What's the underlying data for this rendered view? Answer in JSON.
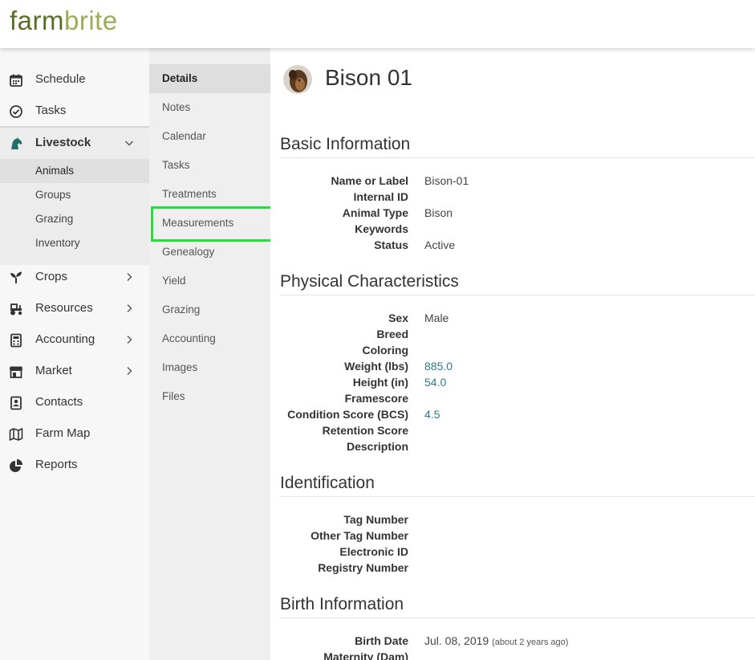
{
  "brand": {
    "part1": "farm",
    "part2": "brite"
  },
  "sidebar": {
    "items": [
      {
        "label": "Schedule",
        "icon": "calendar-icon"
      },
      {
        "label": "Tasks",
        "icon": "check-circle-icon"
      },
      {
        "label": "Livestock",
        "icon": "horse-icon",
        "expanded": true
      },
      {
        "label": "Crops",
        "icon": "sprout-icon"
      },
      {
        "label": "Resources",
        "icon": "tractor-icon"
      },
      {
        "label": "Accounting",
        "icon": "calculator-icon"
      },
      {
        "label": "Market",
        "icon": "store-icon"
      },
      {
        "label": "Contacts",
        "icon": "contact-card-icon"
      },
      {
        "label": "Farm Map",
        "icon": "map-icon"
      },
      {
        "label": "Reports",
        "icon": "pie-chart-icon"
      }
    ],
    "livestock_sub": [
      {
        "label": "Animals",
        "active": true
      },
      {
        "label": "Groups"
      },
      {
        "label": "Grazing"
      },
      {
        "label": "Inventory"
      }
    ]
  },
  "subnav": {
    "items": [
      {
        "label": "Details",
        "active": true
      },
      {
        "label": "Notes"
      },
      {
        "label": "Calendar"
      },
      {
        "label": "Tasks"
      },
      {
        "label": "Treatments"
      },
      {
        "label": "Measurements"
      },
      {
        "label": "Genealogy"
      },
      {
        "label": "Yield"
      },
      {
        "label": "Grazing"
      },
      {
        "label": "Accounting"
      },
      {
        "label": "Images"
      },
      {
        "label": "Files"
      }
    ]
  },
  "main": {
    "title": "Bison 01",
    "sections": {
      "basic": {
        "title": "Basic Information",
        "rows": [
          {
            "label": "Name or Label",
            "value": "Bison-01"
          },
          {
            "label": "Internal ID",
            "value": ""
          },
          {
            "label": "Animal Type",
            "value": "Bison"
          },
          {
            "label": "Keywords",
            "value": ""
          },
          {
            "label": "Status",
            "value": "Active"
          }
        ]
      },
      "physical": {
        "title": "Physical Characteristics",
        "rows": [
          {
            "label": "Sex",
            "value": "Male"
          },
          {
            "label": "Breed",
            "value": ""
          },
          {
            "label": "Coloring",
            "value": ""
          },
          {
            "label": "Weight (lbs)",
            "value": "885.0"
          },
          {
            "label": "Height (in)",
            "value": "54.0"
          },
          {
            "label": "Framescore",
            "value": ""
          },
          {
            "label": "Condition Score (BCS)",
            "value": "4.5"
          },
          {
            "label": "Retention Score",
            "value": ""
          },
          {
            "label": "Description",
            "value": ""
          }
        ]
      },
      "identification": {
        "title": "Identification",
        "rows": [
          {
            "label": "Tag Number",
            "value": ""
          },
          {
            "label": "Other Tag Number",
            "value": ""
          },
          {
            "label": "Electronic ID",
            "value": ""
          },
          {
            "label": "Registry Number",
            "value": ""
          }
        ]
      },
      "birth": {
        "title": "Birth Information",
        "rows": [
          {
            "label": "Birth Date",
            "value": "Jul. 08, 2019",
            "note": "(about 2 years ago)"
          },
          {
            "label": "Maternity (Dam)",
            "value": ""
          }
        ]
      }
    }
  },
  "colors": {
    "brand_dark": "#5a6e2a",
    "brand_light": "#9aae5a",
    "link": "#2a7a8a",
    "highlight": "#22e03a"
  }
}
